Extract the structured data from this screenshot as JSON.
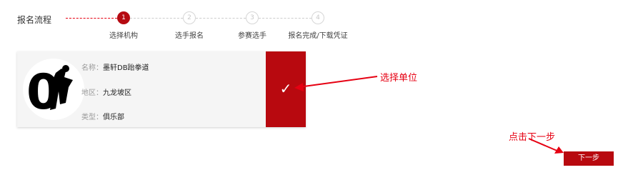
{
  "section_title": "报名流程",
  "steps": [
    {
      "number": "1",
      "label": "选择机构",
      "active": true
    },
    {
      "number": "2",
      "label": "选手报名",
      "active": false
    },
    {
      "number": "3",
      "label": "参赛选手",
      "active": false
    },
    {
      "number": "4",
      "label": "报名完成/下载凭证",
      "active": false
    }
  ],
  "org_card": {
    "name_label": "名称：",
    "name_value": "墨轩DB跆拳道",
    "region_label": "地区：",
    "region_value": "九龙坡区",
    "type_label": "类型：",
    "type_value": "俱乐部",
    "logo_text": "0",
    "check_glyph": "✓"
  },
  "annotations": {
    "select_org_note": "选择单位",
    "next_step_note": "点击下一步"
  },
  "next_button_label": "下一步",
  "colors": {
    "accent": "#b8090f",
    "annotation": "#e60012",
    "inactive": "#cccccc"
  }
}
